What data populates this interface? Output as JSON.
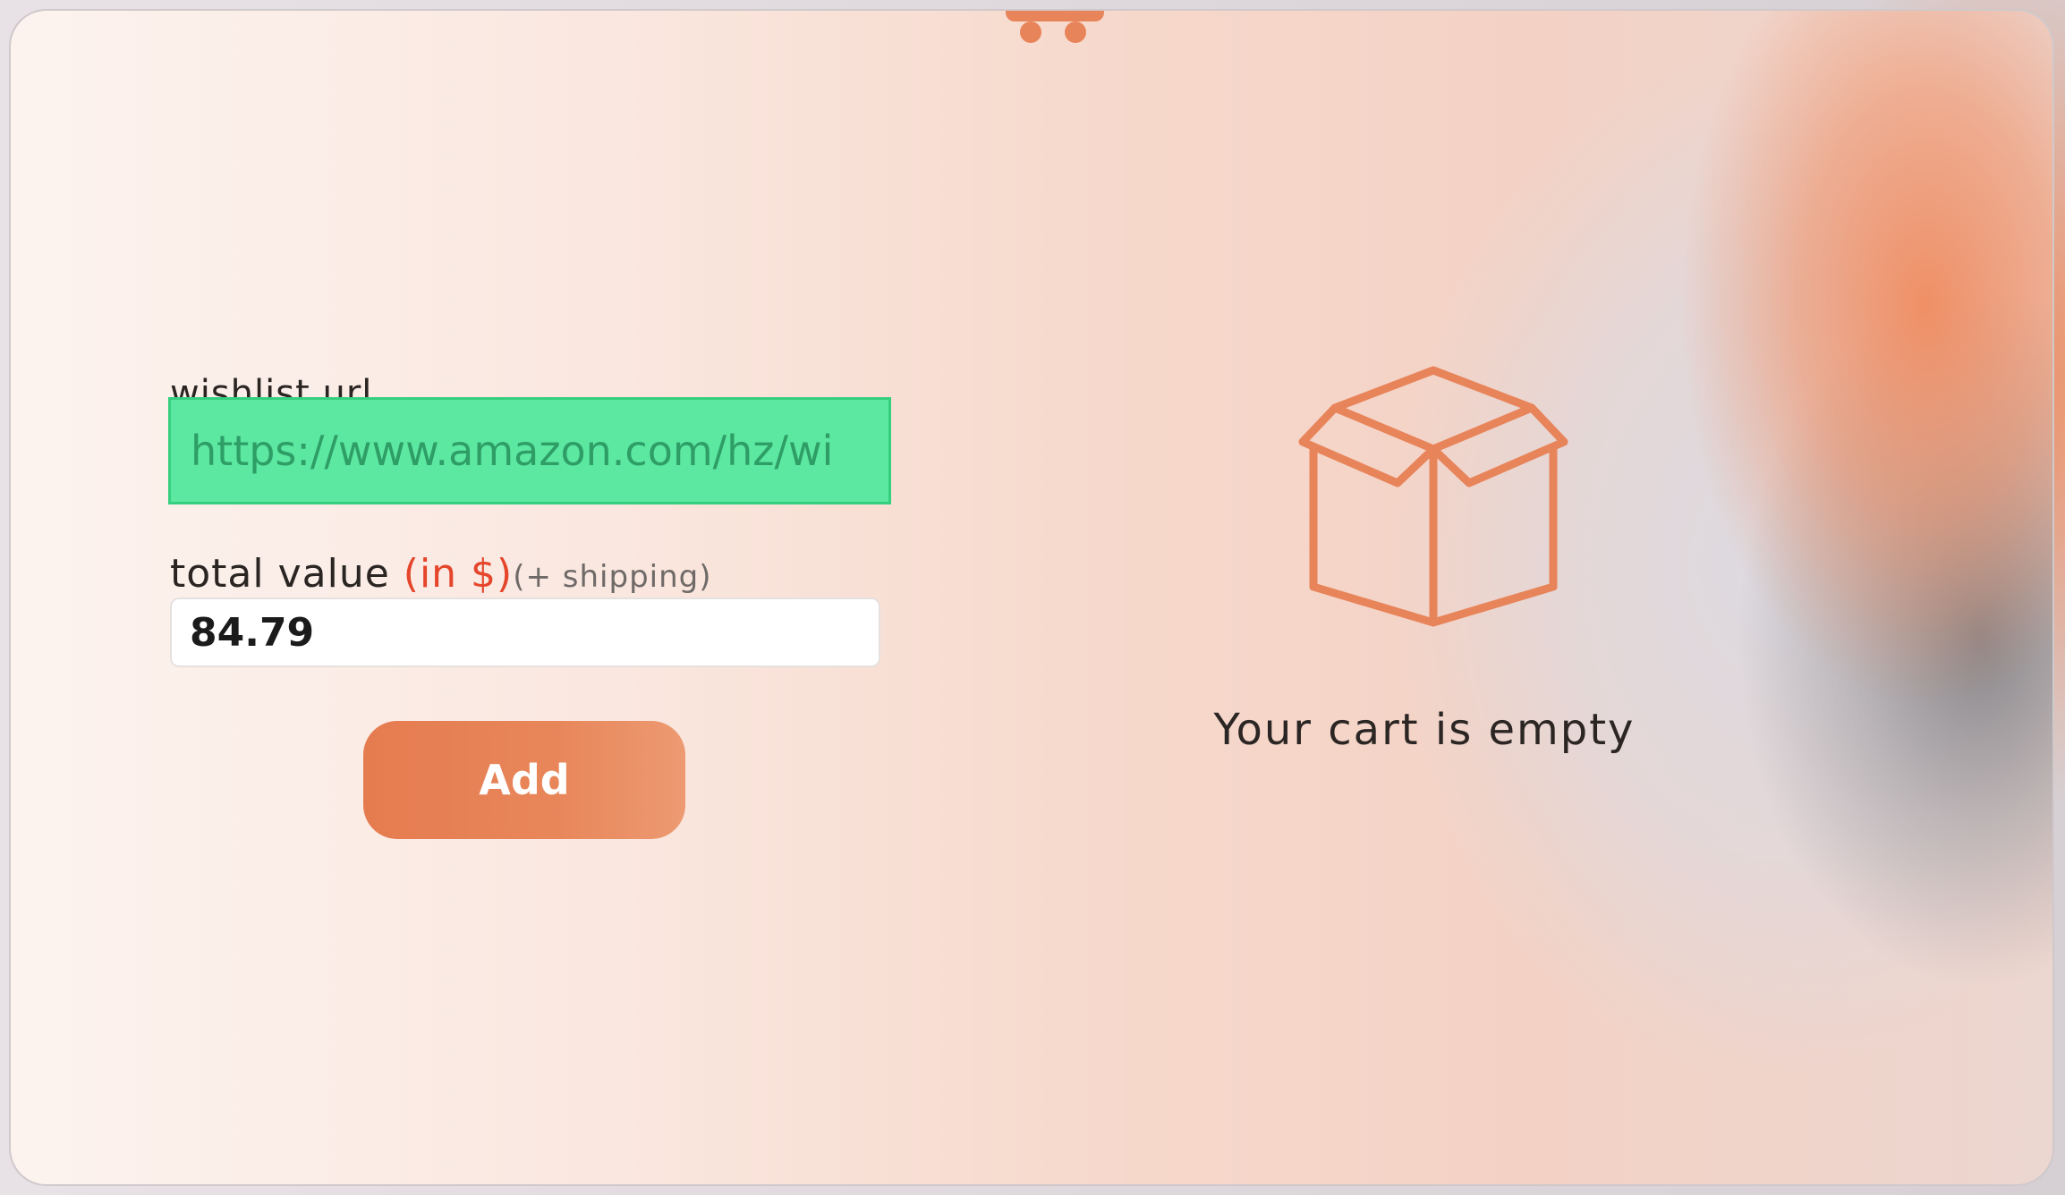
{
  "form": {
    "url_label": "wishlist url",
    "url_value": "https://www.amazon.com/hz/wi",
    "value_label": "total value",
    "value_unit": "(in $)",
    "value_note": "(+ shipping)",
    "value": "84.79",
    "add_label": "Add"
  },
  "cart": {
    "icon": "box-icon",
    "empty_text": "Your cart is empty"
  },
  "colors": {
    "accent": "#e8845a",
    "url_highlight": "#5ce8a1",
    "unit_red": "#e5452b"
  }
}
